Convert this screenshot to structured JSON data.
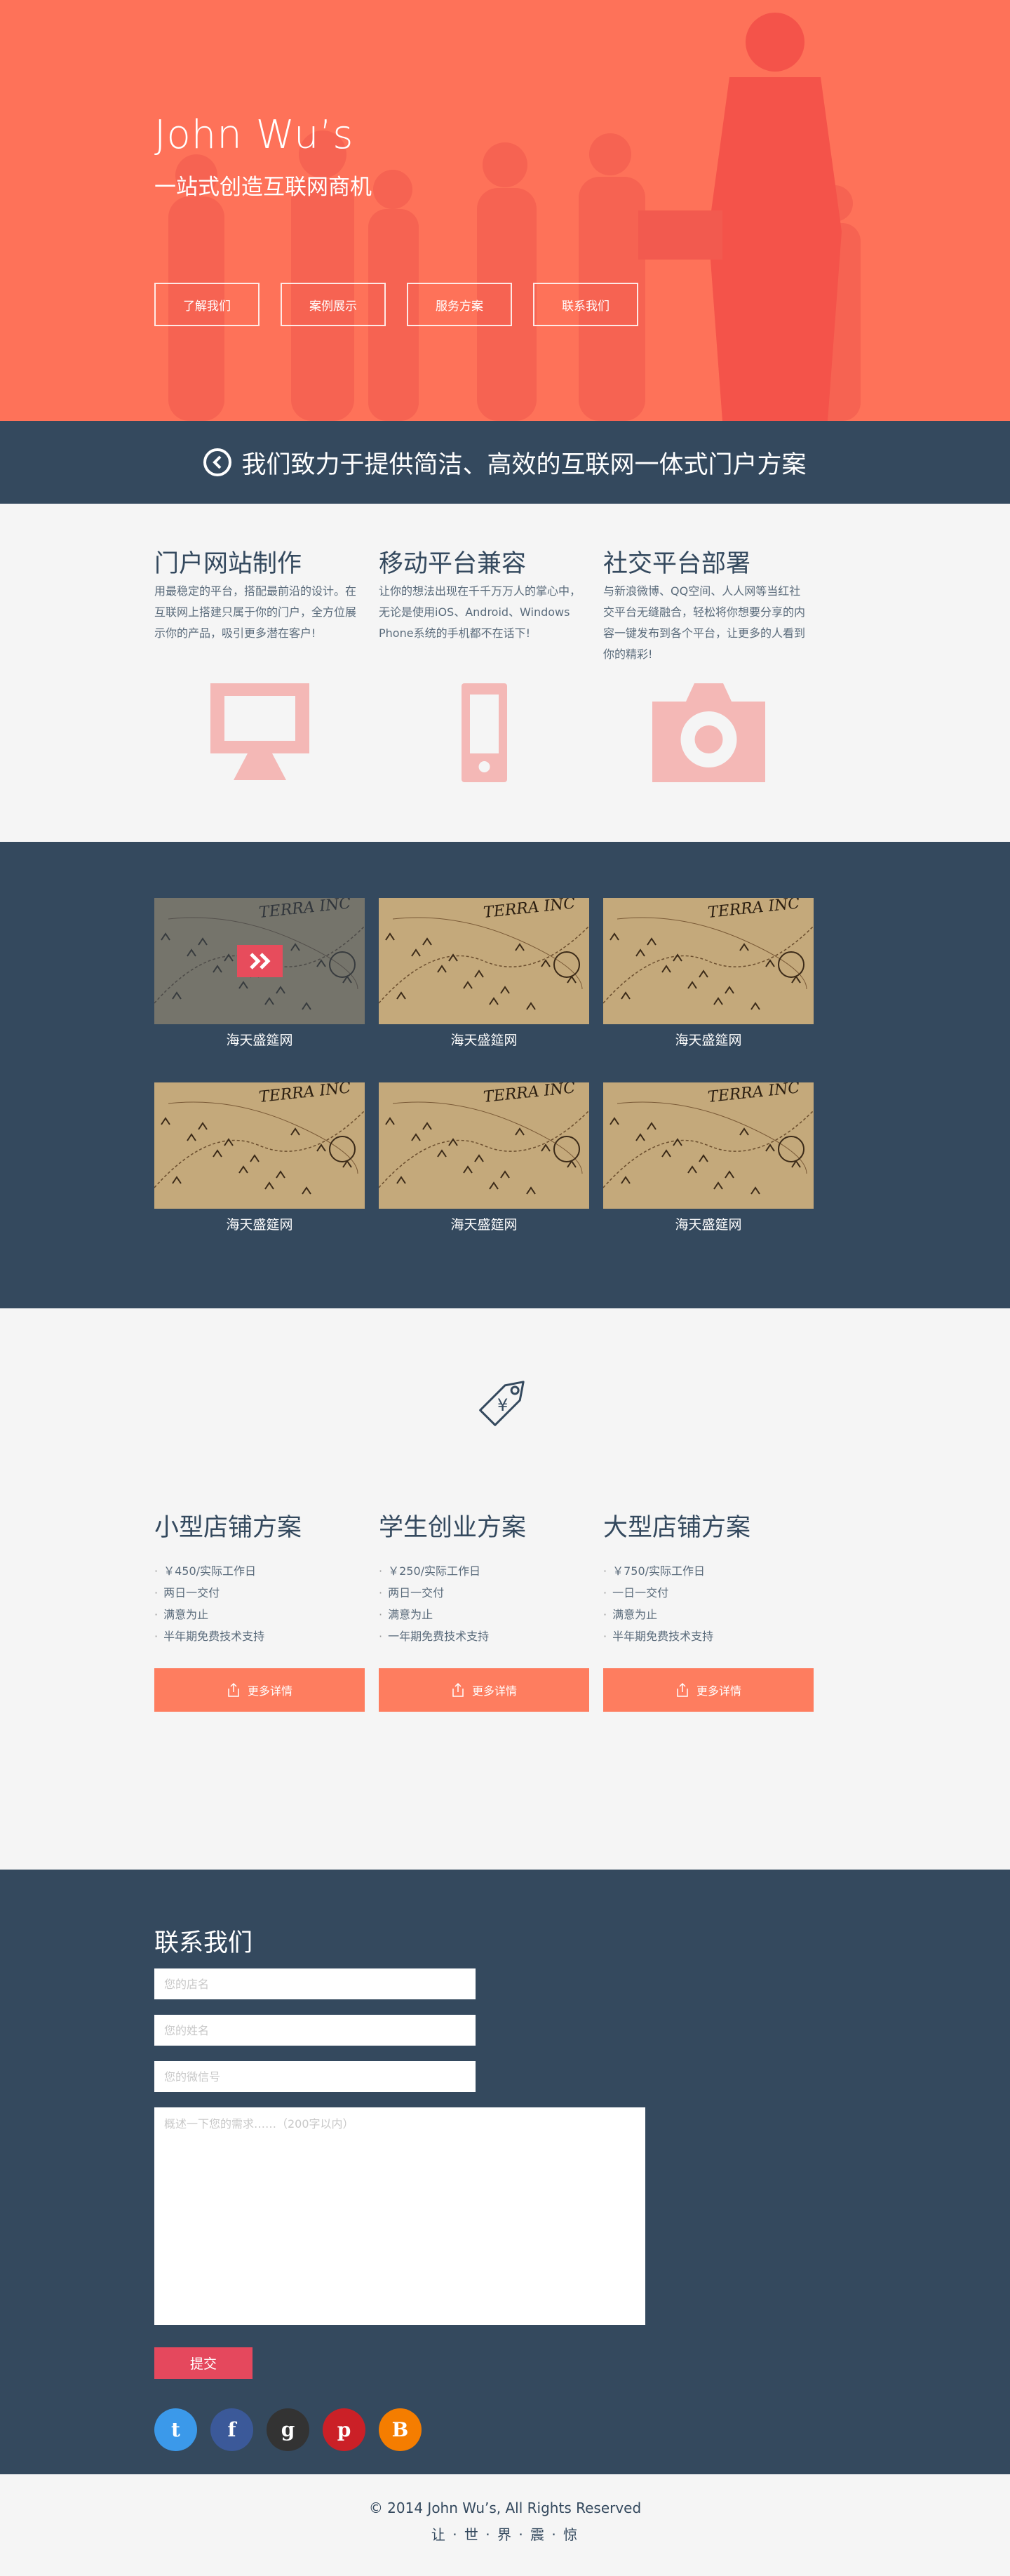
{
  "hero": {
    "title": "John Wu’s",
    "subtitle": "一站式创造互联网商机",
    "nav": [
      "了解我们",
      "案例展示",
      "服务方案",
      "联系我们"
    ]
  },
  "banner": {
    "text": "我们致力于提供简洁、高效的互联网一体式门户方案"
  },
  "services": [
    {
      "title": "门户网站制作",
      "desc": "用最稳定的平台，搭配最前沿的设计。在互联网上搭建只属于你的门户，全方位展示你的产品，吸引更多潜在客户!",
      "icon": "monitor-icon"
    },
    {
      "title": "移动平台兼容",
      "desc": "让你的想法出现在千千万万人的掌心中，无论是使用iOS、Android、Windows Phone系统的手机都不在话下!",
      "icon": "mobile-icon"
    },
    {
      "title": "社交平台部署",
      "desc": "与新浪微博、QQ空间、人人网等当红社交平台无缝融合，轻松将你想要分享的内容一键发布到各个平台，让更多的人看到你的精彩!",
      "icon": "camera-icon"
    }
  ],
  "portfolio": {
    "items": [
      {
        "caption": "海天盛筵网",
        "label": "TERRA INC"
      },
      {
        "caption": "海天盛筵网",
        "label": "TERRA INC"
      },
      {
        "caption": "海天盛筵网",
        "label": "TERRA INC"
      },
      {
        "caption": "海天盛筵网",
        "label": "TERRA INC"
      },
      {
        "caption": "海天盛筵网",
        "label": "TERRA INC"
      },
      {
        "caption": "海天盛筵网",
        "label": "TERRA INC"
      }
    ]
  },
  "pricing": {
    "tag_symbol": "¥",
    "plans": [
      {
        "title": "小型店铺方案",
        "features": [
          "￥450/实际工作日",
          "两日一交付",
          "满意为止",
          "半年期免费技术支持"
        ],
        "button": "更多详情"
      },
      {
        "title": "学生创业方案",
        "features": [
          "￥250/实际工作日",
          "两日一交付",
          "满意为止",
          "一年期免费技术支持"
        ],
        "button": "更多详情"
      },
      {
        "title": "大型店铺方案",
        "features": [
          "￥750/实际工作日",
          "一日一交付",
          "满意为止",
          "半年期免费技术支持"
        ],
        "button": "更多详情"
      }
    ]
  },
  "contact": {
    "title": "联系我们",
    "name_placeholder": "您的店名",
    "surname_placeholder": "您的姓名",
    "wechat_placeholder": "您的微信号",
    "message_placeholder": "概述一下您的需求……（200字以内）",
    "submit": "提交",
    "socials": [
      {
        "name": "twitter-icon",
        "glyph": "t",
        "color": "#3b99ea"
      },
      {
        "name": "facebook-icon",
        "glyph": "f",
        "color": "#3b5999"
      },
      {
        "name": "github-icon",
        "glyph": "g",
        "color": "#333333"
      },
      {
        "name": "pinterest-icon",
        "glyph": "p",
        "color": "#cb2027"
      },
      {
        "name": "blogger-icon",
        "glyph": "B",
        "color": "#f57d00"
      }
    ]
  },
  "footer": {
    "copyright": "© 2014  John Wu’s, All Rights Reserved",
    "tagline": "让 · 世 · 界 · 震 · 惊"
  },
  "colors": {
    "accent": "#fe7259",
    "dark": "#34495e",
    "light": "#f5f5f5",
    "button": "#fe7d5f",
    "submit": "#e5485d",
    "icon_pink": "#f4b8b6"
  }
}
